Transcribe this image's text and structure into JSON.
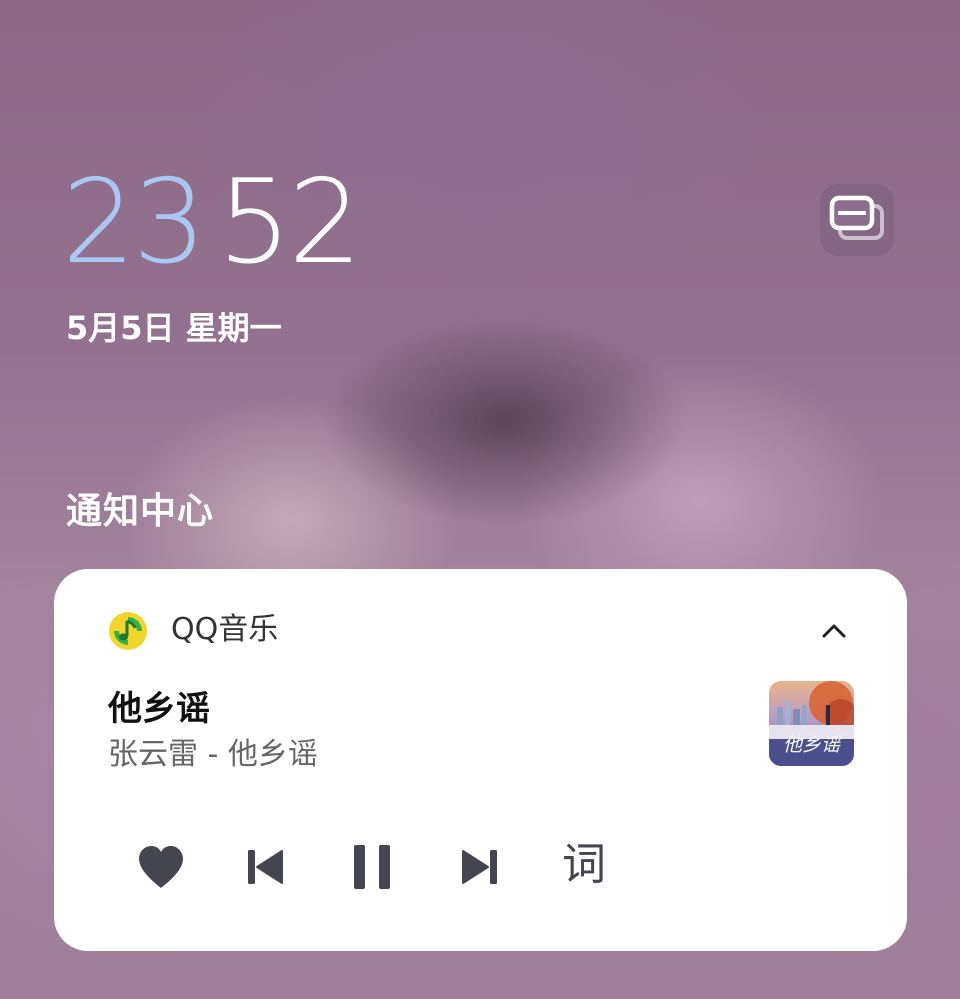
{
  "lockscreen": {
    "clock_hours": "23",
    "clock_minutes": "52",
    "date": "5月5日 星期一",
    "notification_center_title": "通知中心",
    "toggle_icon": "card-stack-icon"
  },
  "notification": {
    "app_name": "QQ音乐",
    "app_icon": "qq-music-icon",
    "collapse_icon": "chevron-up-icon",
    "song_title": "他乡谣",
    "song_subtitle": "张云雷 - 他乡谣",
    "cover_text": "他乡谣",
    "controls": {
      "like_icon": "heart-icon",
      "prev_icon": "skip-previous-icon",
      "pause_icon": "pause-icon",
      "next_icon": "skip-next-icon",
      "lyrics_label": "词"
    }
  },
  "colors": {
    "hour_accent": "#a9c7f2",
    "card_background": "#ffffff",
    "control_color": "#454550",
    "app_icon_yellow": "#f2d52a",
    "app_icon_green": "#33b24a"
  }
}
